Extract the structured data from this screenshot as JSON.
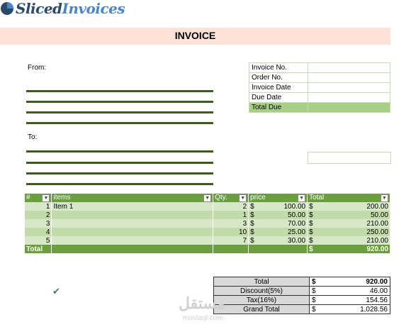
{
  "brand": {
    "name_part1": "Sliced",
    "name_part2": "Invoices",
    "color": "#2b4a6a",
    "accent": "#4a86c5"
  },
  "title": "INVOICE",
  "from_label": "From:",
  "to_label": "To:",
  "info": [
    {
      "label": "Invoice No.",
      "value": ""
    },
    {
      "label": "Order No.",
      "value": ""
    },
    {
      "label": "Invoice Date",
      "value": ""
    },
    {
      "label": "Due Date",
      "value": ""
    },
    {
      "label": "Total Due",
      "value": ""
    }
  ],
  "items": {
    "headers": [
      "#",
      "items",
      "Qty.",
      "price",
      "Total"
    ],
    "rows": [
      {
        "num": "1",
        "item": "Item 1",
        "qty": "2",
        "cur": "$",
        "price": "100.00",
        "tcur": "$",
        "total": "200.00"
      },
      {
        "num": "2",
        "item": "",
        "qty": "1",
        "cur": "$",
        "price": "50.00",
        "tcur": "$",
        "total": "50.00"
      },
      {
        "num": "3",
        "item": "",
        "qty": "3",
        "cur": "$",
        "price": "70.00",
        "tcur": "$",
        "total": "210.00"
      },
      {
        "num": "4",
        "item": "",
        "qty": "10",
        "cur": "$",
        "price": "25.00",
        "tcur": "$",
        "total": "250.00"
      },
      {
        "num": "5",
        "item": "",
        "qty": "7",
        "cur": "$",
        "price": "30.00",
        "tcur": "$",
        "total": "210.00"
      }
    ],
    "footer": {
      "label": "Total",
      "cur": "$",
      "value": "920.00"
    }
  },
  "summary": [
    {
      "label": "Total",
      "cur": "$",
      "value": "920.00"
    },
    {
      "label": "Discount(5%)",
      "cur": "$",
      "value": "46.00"
    },
    {
      "label": "Tax(16%)",
      "cur": "$",
      "value": "154.56"
    },
    {
      "label": "Grand Total",
      "cur": "$",
      "value": "1,028.56"
    }
  ],
  "check_icon": "checkmark-icon",
  "watermark": {
    "arabic": "مستقل",
    "latin": "mostaql.com"
  },
  "colors": {
    "header_band": "#fde3d7",
    "table_header": "#6a9e3e",
    "row_light": "#d7e8c8",
    "row_dark": "#c2dca9",
    "total_due": "#a8cf86",
    "rule": "#3d5a1f"
  }
}
